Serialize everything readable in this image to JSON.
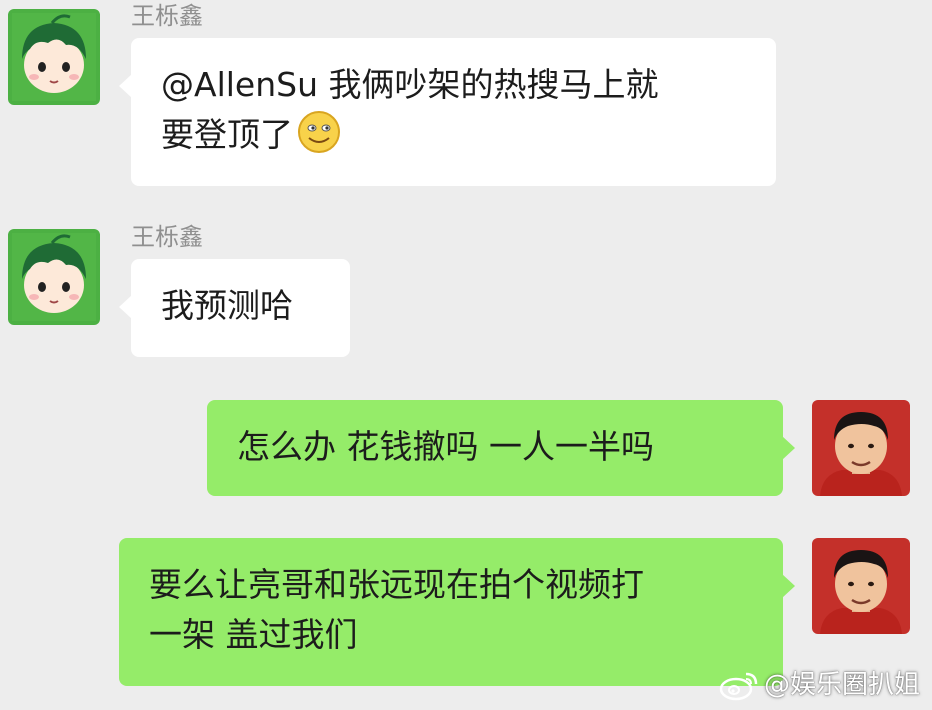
{
  "colors": {
    "background": "#ededed",
    "incoming_bubble": "#ffffff",
    "outgoing_bubble": "#95ec69",
    "sender_name": "#8f8f8f",
    "text": "#1c1c1c"
  },
  "messages": [
    {
      "direction": "incoming",
      "sender": "王栎鑫",
      "lines": [
        "@AllenSu 我俩吵架的热搜马上就",
        "要登顶了"
      ],
      "emoji": "smiley-face-icon"
    },
    {
      "direction": "incoming",
      "sender": "王栎鑫",
      "lines": [
        "我预测哈"
      ]
    },
    {
      "direction": "outgoing",
      "lines": [
        "怎么办 花钱撤吗 一人一半吗"
      ]
    },
    {
      "direction": "outgoing",
      "lines": [
        "要么让亮哥和张远现在拍个视频打",
        "一架 盖过我们"
      ]
    }
  ],
  "watermark": {
    "text": "@娱乐圈扒姐",
    "icon": "weibo-logo-icon"
  }
}
